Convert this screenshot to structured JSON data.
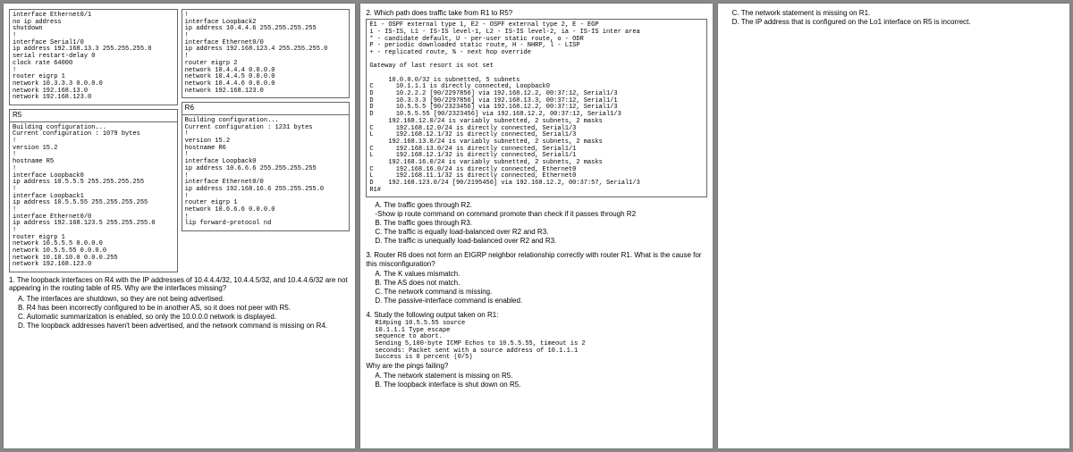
{
  "page1": {
    "leftConfigTop": "interface Ethernet0/1\nno ip address\nshutdown\n!\ninterface Serial1/0\nip address 192.168.13.3 255.255.255.0\nserial restart-delay 0\nclock rate 64000\n!\nrouter eigrp 1\nnetwork 10.3.3.3 0.0.0.0\nnetwork 192.168.13.0\nnetwork 192.168.123.0",
    "rightConfigTop": "!\ninterface Loopback2\nip address 10.4.4.6 255.255.255.255\n!\ninterface Ethernet0/0\nip address 192.168.123.4 255.255.255.0\n!\nrouter eigrp 2\nnetwork 10.4.4.4 0.0.0.0\nnetwork 10.4.4.5 0.0.0.0\nnetwork 10.4.4.6 0.0.0.0\nnetwork 192.168.123.0",
    "r5hdr": "R5",
    "r5cfg": "Building configuration...\nCurrent configuration : 1079 bytes\n!\nversion 15.2\n!\nhostname R5\n!\ninterface Loopback0\nip address 10.5.5.5 255.255.255.255\n!\ninterface Loopback1\nip address 10.5.5.55 255.255.255.255\n!\ninterface Ethernet0/0\nip address 192.168.123.5 255.255.255.0\n!\nrouter eigrp 1\nnetwork 10.5.5.5 0.0.0.0\nnetwork 10.5.5.55 0.0.0.0\nnetwork 10.10.10.0 0.0.0.255\nnetwork 192.168.123.0",
    "r6hdr": "R6",
    "r6cfg": "Building configuration...\nCurrent configuration : 1231 bytes\n!\nversion 15.2\nhostname R6\n!\ninterface Loopback0\nip address 10.6.6.6 255.255.255.255\n!\ninterface Ethernet0/0\nip address 192.168.16.6 255.255.255.0\n!\nrouter eigrp 1\nnetwork 10.6.6.6 0.0.0.0\n!\nlip forward-protocol nd",
    "q1text": "1. The loopback interfaces on R4 with the IP addresses of 10.4.4.4/32, 10.4.4.5/32, and 10.4.4.6/32 are not appearing in the routing table of R5. Why are the interfaces missing?",
    "q1a": "A.  The interfaces are shutdown, so they are not being advertised.",
    "q1b": "B.  R4 has been incorrectly configured to be in another AS, so it does not peer with R5.",
    "q1c": "C.  Automatic summarization is enabled, so only the 10.0.0.0 network is displayed.",
    "q1d": "D.  The loopback addresses haven't been advertised, and the network command is missing on R4."
  },
  "page2": {
    "q2title": "2. Which path does traffic take from R1 to R5?",
    "routeBox": "E1 - OSPF external type 1, E2 - OSPF external type 2, E - EGP\ni - IS-IS, L1 - IS-IS level-1, L2 - IS-IS level-2, ia - IS-IS inter area\n* - candidate default, U - per-user static route, o - ODR\nP - periodic downloaded static route, H - NHRP, l - LISP\n+ - replicated route, % - next hop override\n\nGateway of last resort is not set\n\n     10.0.0.0/32 is subnetted, 5 subnets\nC      10.1.1.1 is directly connected, Loopback0\nD      10.2.2.2 [90/2297856] via 192.168.12.2, 00:37:12, Serial1/3\nD      10.3.3.3 [90/2297856] via 192.168.13.3, 00:37:12, Serial1/1\nD      10.5.5.5 [90/2323456] via 192.168.12.2, 00:37:12, Serial1/3\nD      10.5.5.55 [90/2323456] via 192.168.12.2, 00:37:12, Serial1/3\n     192.168.12.0/24 is variably subnetted, 2 subnets, 2 masks\nC      192.168.12.0/24 is directly connected, Serial1/3\nL      192.168.12.1/32 is directly connected, Serial1/3\n     192.168.13.0/24 is variably subnetted, 2 subnets, 2 masks\nC      192.168.13.0/24 is directly connected, Serial1/1\nL      192.168.12.1/32 is directly connected, Serial1/1\n     192.168.16.0/24 is variably subnetted, 2 subnets, 2 masks\nC      192.168.16.0/24 is directly connected, Ethernet0\nL      192.168.11.1/32 is directly connected, Ethernet0\nD    192.168.123.0/24 [90/2195456] via 192.168.12.2, 00:37:57, Serial1/3\nR1#",
    "q2a": "A.  The traffic goes through R2.",
    "q2hint": "-Show ip route command on command promote than check if it passes through R2",
    "q2b": "B.  The traffic goes through R3.",
    "q2c": "C.  The traffic is equally load-balanced over R2 and R3.",
    "q2d": "D.  The traffic is unequally load-balanced over R2 and R3.",
    "q3title": "3. Router R6 does not form an EIGRP neighbor relationship correctly with router R1. What is the cause for this misconfiguration?",
    "q3a": "A.  The K values mismatch.",
    "q3b": "B.  The AS does not match.",
    "q3c": "C.  The network command is missing.",
    "q3d": "D.  The passive-interface command is enabled.",
    "q4title": "4. Study the following output taken on R1:",
    "q4out": "R1#ping 10.5.5.55 source\n10.1.1.1 Type escape\nsequence to abort.\nSending 5,100-byte ICMP Echos to 10.5.5.55, timeout is 2\nseconds: Packet sent with a source address of 10.1.1.1\nSuccess is 0 percent (0/5)",
    "q4why": "Why are the pings failing?",
    "q4a": "A.  The network statement is missing on R5.",
    "q4b": "B.  The loopback interface is shut down on R5."
  },
  "page3": {
    "q4c": "C.  The network statement is missing on R1.",
    "q4d": "D.  The IP address that is configured on the Lo1 interface on R5 is incorrect."
  }
}
